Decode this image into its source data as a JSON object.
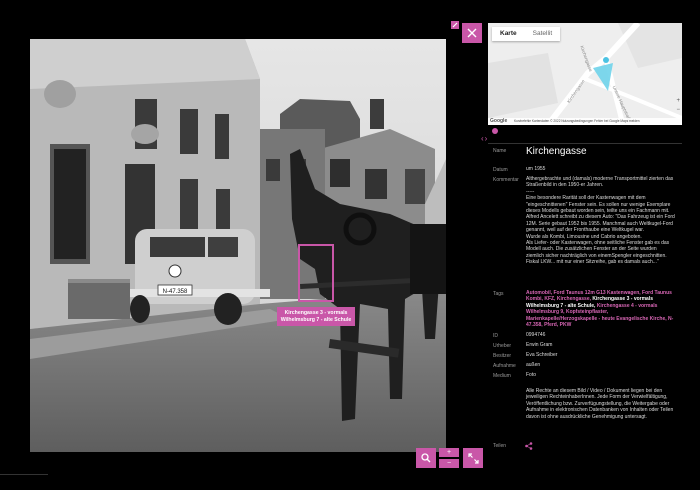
{
  "photo": {
    "tag_label": "Kirchengasse 3 - vormals Wilhelmsburg 7 - alte Schule",
    "license_plate": "N-47.358"
  },
  "map": {
    "tabs": [
      "Karte",
      "Satellit"
    ],
    "streets": [
      "Kirchengasse",
      "Kirchengasse",
      "Untere Hauptstraße"
    ],
    "footer": "Kurzbefehle   Kartendaten © 2022   Nutzungsbedingungen   Fehler bei Google Maps melden",
    "logo": "Google",
    "zoom_in": "+",
    "zoom_out": "−"
  },
  "nav": {
    "prev": "‹",
    "next": "›"
  },
  "detail": {
    "name_label": "Name",
    "name": "Kirchengasse",
    "date_label": "Datum",
    "date": "um 1955",
    "comment_label": "Kommentar",
    "comment_lines": [
      "Althergebrachte und (damals) moderne Transportmittel zierten das Straßenbild in den 1950-er Jahren.",
      "-----",
      "Eine besondere Rarität soll der Kastenwagen mit dem \"eingeschnittenen\" Fenster sein. Es sollen nur wenige Exemplare dieses Modells gebaut worden sein, teilte uns ein Fachmann mit.",
      "Alfred Ancelett schreibt zu diesem Auto: \"Das Fahrzeug ist ein Ford 12M. Serie gebaut 1952 bis 1955. Manchmal auch Weltkugel-Ford genannt, weil auf der Fronthaube eine Weltkugel war.",
      "Wurde als Kombi, Limousine und Cabrio angeboten.",
      "Als Liefer- oder Kastenwagen, ohne seitliche Fenster gab es das Modell auch. Die zusätzlichen Fenster an der Seite wurden ziemlich sicher nachträglich von einemSpengler eingeschnitten. Fiskal LKW... mit nur einer Sitzreihe, gab es damals auch...\""
    ],
    "tags_label": "Tags",
    "tags": [
      {
        "text": "Automobil, Ford Taunus 12m G13 Kastenwagen, Ford Taunus Kombi, KFZ, Kirchengasse, ",
        "style": "pink"
      },
      {
        "text": "Kirchengasse 3 - vormals Wilhelmsburg 7 - alte Schule, ",
        "style": "white"
      },
      {
        "text": "Kirchengasse 4 - vormals Wilhelmsburg 9, Kopfsteinpflaster, Marienkapelle/Herzogskapelle - heute Evangelische Kirche, N-47.358, Pferd, PKW",
        "style": "pink"
      }
    ],
    "id_label": "ID",
    "id": "0994746",
    "author_label": "Urheber",
    "author": "Erwin Gram",
    "owner_label": "Besitzer",
    "owner": "Eva Schreiber",
    "recording_label": "Aufnahme",
    "recording": "außen",
    "medium_label": "Medium",
    "medium": "Foto",
    "rights": "Alle Rechte an diesem Bild / Video / Dokument liegen bei den jeweiligen RechteinhaberInnen. Jede Form der Verwielfältigung, Veröffentlichung bzw. Zurverfügungstellung, die Weitergabe oder Aufnahme in elektronischen Datenbanken von Inhalten oder Teilen davon ist ohne ausdrückliche Genehmigung untersagt.",
    "share_label": "Teilen"
  },
  "colors": {
    "accent": "#c957a8",
    "background": "#000000",
    "tag_link": "#d866b5"
  },
  "icons": {
    "close": "close-icon",
    "search": "search-icon",
    "fullscreen": "fullscreen-icon",
    "share": "share-icon",
    "map_pin": "location-icon"
  }
}
